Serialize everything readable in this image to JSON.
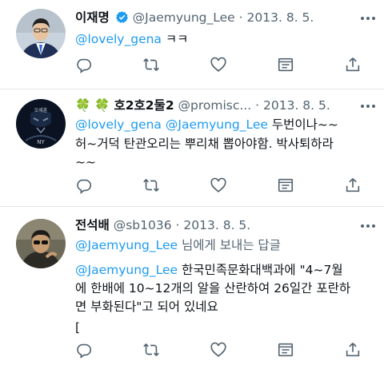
{
  "tweets": [
    {
      "author": "이재명",
      "verified": true,
      "handle": "@Jaemyung_Lee",
      "separator": "·",
      "date": "2013. 8. 5.",
      "mention": "@lovely_gena",
      "text": "ㅋㅋ"
    },
    {
      "author_emoji": "🍀 🍀",
      "author": "호2호2둘2",
      "handle": "@promisc...",
      "separator": "·",
      "date": "2013. 8. 5.",
      "mention1": "@lovely_gena",
      "mention2": "@Jaemyung_Lee",
      "line1_text": "두번이나~~",
      "line2": "허~거덕 탄관오리는 뿌리채 뽑아야함. 박사퇴하라",
      "line3": "~~",
      "avatar_text_top": "오세훈",
      "avatar_text_bottom": "NY"
    },
    {
      "author": "전석배",
      "handle": "@sb1036",
      "separator": "·",
      "date": "2013. 8. 5.",
      "reply_mention": "@Jaemyung_Lee",
      "reply_suffix": "님에게 보내는 답글",
      "mention": "@Jaemyung_Lee",
      "line1_text": "한국민족문화대백과에 \"4~7월",
      "line2": "에 한배에 10~12개의 알을 산란하여 26일간 포란하",
      "line3": "면 부화된다\"고 되어 있네요",
      "line4": "["
    }
  ],
  "icons": [
    "reply-icon",
    "retweet-icon",
    "like-icon",
    "share-icon"
  ],
  "colors": {
    "link": "#1d9bf0",
    "meta": "#536471",
    "icon": "#536471",
    "verified": "#1d9bf0"
  }
}
